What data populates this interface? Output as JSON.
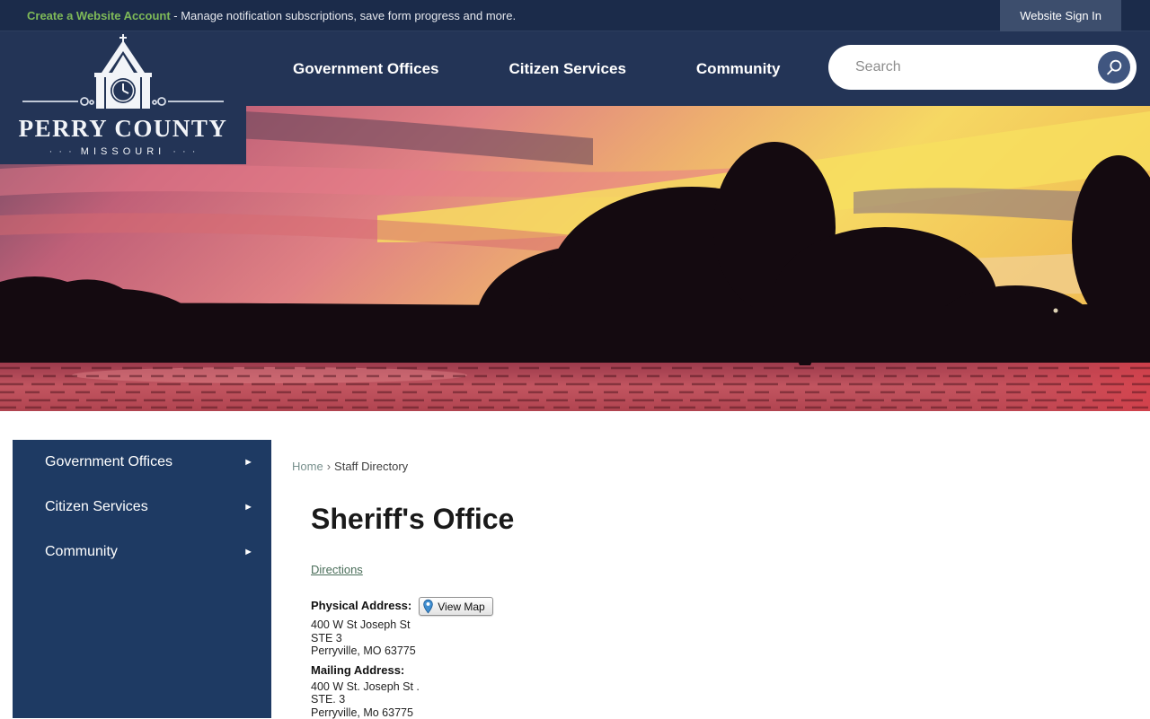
{
  "topbar": {
    "account_link": "Create a Website Account",
    "account_text": " - Manage notification subscriptions, save form progress and more.",
    "signin_button": "Website Sign In"
  },
  "header": {
    "logo": {
      "title": "PERRY COUNTY",
      "subtitle": "MISSOURI",
      "dots": "· · ·"
    },
    "nav": [
      {
        "label": "Government Offices"
      },
      {
        "label": "Citizen Services"
      },
      {
        "label": "Community"
      }
    ],
    "search": {
      "placeholder": "Search"
    }
  },
  "sidebar": {
    "arrow": "►",
    "items": [
      {
        "label": "Government Offices"
      },
      {
        "label": "Citizen Services"
      },
      {
        "label": "Community"
      }
    ]
  },
  "main": {
    "breadcrumb": {
      "home": "Home",
      "separator": "›",
      "current": "Staff Directory"
    },
    "title": "Sheriff's Office",
    "directions_link": "Directions",
    "physical": {
      "label": "Physical Address:",
      "view_map": "View Map",
      "lines": [
        "400 W St Joseph St",
        "STE 3",
        "Perryville, MO 63775"
      ]
    },
    "mailing": {
      "label": "Mailing Address:",
      "lines": [
        "400 W St. Joseph St .",
        "STE. 3",
        "Perryville, Mo 63775"
      ]
    }
  },
  "colors": {
    "topbar_bg": "#1b2b4a",
    "header_bg": "#233456",
    "sidebar_bg": "#1e3a63",
    "accent_green": "#7fba58",
    "signin_bg": "#3d4e6d",
    "search_button_bg": "#405680"
  }
}
